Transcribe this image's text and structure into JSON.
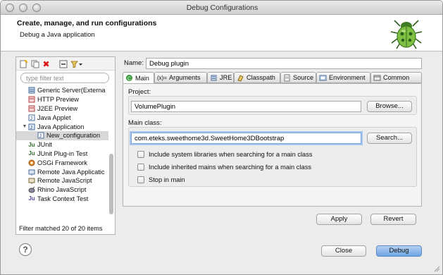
{
  "window": {
    "title": "Debug Configurations"
  },
  "header": {
    "title": "Create, manage, and run configurations",
    "subtitle": "Debug a Java application"
  },
  "left_panel": {
    "filter_placeholder": "type filter text",
    "tree": [
      {
        "label": "Generic Server(Externa",
        "icon": "server-icon",
        "indent": 1
      },
      {
        "label": "HTTP Preview",
        "icon": "http-preview-icon",
        "indent": 1
      },
      {
        "label": "J2EE Preview",
        "icon": "j2ee-preview-icon",
        "indent": 1
      },
      {
        "label": "Java Applet",
        "icon": "java-applet-icon",
        "indent": 1
      },
      {
        "label": "Java Application",
        "icon": "java-application-icon",
        "indent": 1,
        "expanded": true
      },
      {
        "label": "New_configuration",
        "icon": "java-config-icon",
        "indent": 2,
        "selected": true
      },
      {
        "label": "JUnit",
        "icon": "junit-icon",
        "indent": 1
      },
      {
        "label": "JUnit Plug-in Test",
        "icon": "junit-plugin-icon",
        "indent": 1
      },
      {
        "label": "OSGi Framework",
        "icon": "osgi-icon",
        "indent": 1
      },
      {
        "label": "Remote Java Applicatic",
        "icon": "remote-java-icon",
        "indent": 1
      },
      {
        "label": "Remote JavaScript",
        "icon": "remote-javascript-icon",
        "indent": 1
      },
      {
        "label": "Rhino JavaScript",
        "icon": "rhino-icon",
        "indent": 1
      },
      {
        "label": "Task Context Test",
        "icon": "task-context-icon",
        "indent": 1
      }
    ],
    "status": "Filter matched 20 of 20 items"
  },
  "config": {
    "name_label": "Name:",
    "name_value": "Debug plugin",
    "tabs": [
      {
        "label": "Main",
        "icon": "main-tab-icon",
        "active": true
      },
      {
        "label": "Arguments",
        "icon": "arguments-tab-icon",
        "prefix": "(x)="
      },
      {
        "label": "JRE",
        "icon": "jre-tab-icon"
      },
      {
        "label": "Classpath",
        "icon": "classpath-tab-icon"
      },
      {
        "label": "Source",
        "icon": "source-tab-icon"
      },
      {
        "label": "Environment",
        "icon": "environment-tab-icon"
      },
      {
        "label": "Common",
        "icon": "common-tab-icon"
      }
    ],
    "project_label": "Project:",
    "project_value": "VolumePlugin",
    "browse_label": "Browse...",
    "main_class_label": "Main class:",
    "main_class_value": "com.eteks.sweethome3d.SweetHome3DBootstrap",
    "search_label": "Search...",
    "checkboxes": [
      {
        "label": "Include system libraries when searching for a main class",
        "checked": false
      },
      {
        "label": "Include inherited mains when searching for a main class",
        "checked": false
      },
      {
        "label": "Stop in main",
        "checked": false
      }
    ],
    "apply_label": "Apply",
    "revert_label": "Revert"
  },
  "footer": {
    "help_glyph": "?",
    "close_label": "Close",
    "debug_label": "Debug"
  },
  "colors": {
    "window_bg": "#ececec",
    "accent": "#6ea4e3",
    "selection": "#d8d8d8",
    "focus_ring": "#a9c6ea"
  }
}
